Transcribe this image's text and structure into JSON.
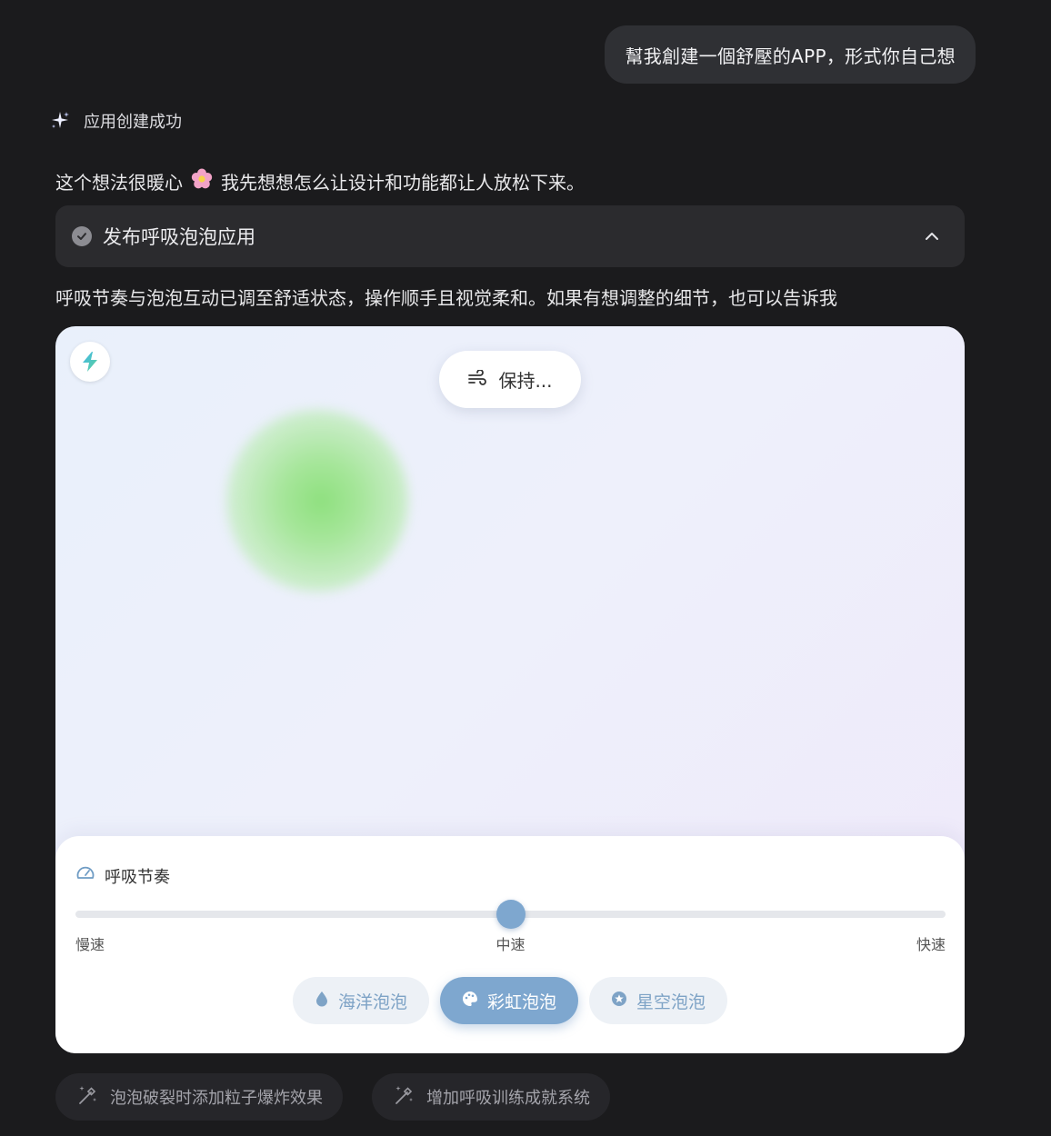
{
  "user_message": "幫我創建一個舒壓的APP，形式你自己想",
  "status": {
    "icon": "sparkle-icon",
    "text": "应用创建成功"
  },
  "intro": {
    "before": "这个想法很暖心",
    "emoji": "🌸",
    "after": "我先想想怎么让设计和功能都让人放松下来。"
  },
  "accordion": {
    "icon": "check-circle-icon",
    "title": "发布呼吸泡泡应用",
    "expanded": true
  },
  "summary": "呼吸节奏与泡泡互动已调至舒适状态，操作顺手且视觉柔和。如果有想调整的细节，也可以告诉我",
  "app": {
    "badge_icon": "bolt-icon",
    "phase_icon": "wind-icon",
    "phase_label": "保持...",
    "bubble_color": "#8ee07e",
    "panel": {
      "title_icon": "speedometer-icon",
      "title": "呼吸节奏",
      "slider": {
        "value": 0.5,
        "labels": [
          "慢速",
          "中速",
          "快速"
        ]
      },
      "themes": [
        {
          "label": "海洋泡泡",
          "icon": "droplet-icon",
          "active": false
        },
        {
          "label": "彩虹泡泡",
          "icon": "palette-icon",
          "active": true
        },
        {
          "label": "星空泡泡",
          "icon": "star-icon",
          "active": false
        }
      ]
    }
  },
  "suggestions": [
    {
      "icon": "magic-wand-icon",
      "label": "泡泡破裂时添加粒子爆炸效果"
    },
    {
      "icon": "magic-wand-icon",
      "label": "增加呼吸训练成就系统"
    }
  ],
  "colors": {
    "accent": "#7ea7cf",
    "background": "#1b1b1d",
    "bubble": "#2f3034"
  }
}
